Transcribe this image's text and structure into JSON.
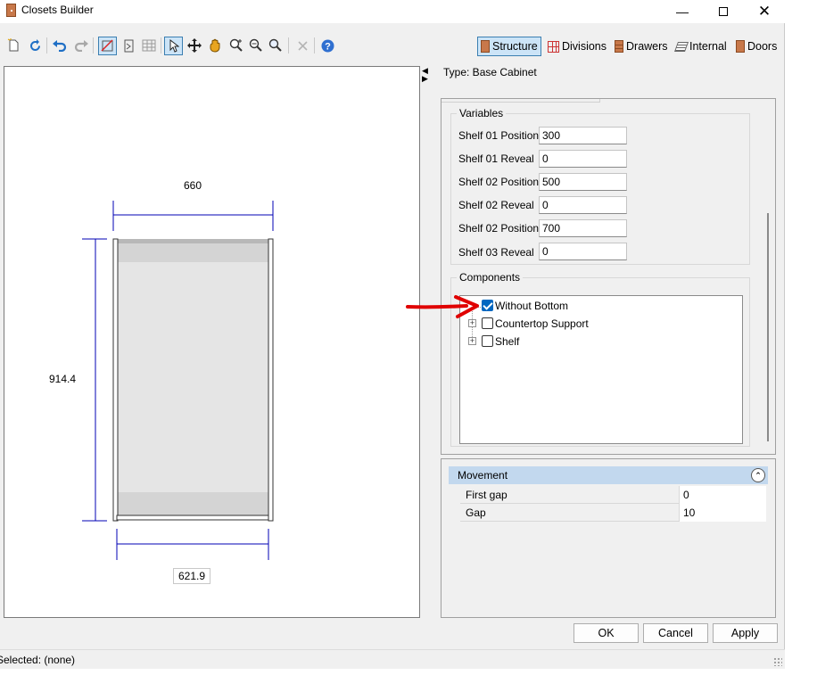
{
  "window": {
    "title": "Closets Builder"
  },
  "toolbar": {
    "tabs": [
      {
        "label": "Structure",
        "icon": "cabinet-icon"
      },
      {
        "label": "Divisions",
        "icon": "grid-icon"
      },
      {
        "label": "Drawers",
        "icon": "drawer-icon"
      },
      {
        "label": "Internal",
        "icon": "internal-icon"
      },
      {
        "label": "Doors",
        "icon": "door-icon"
      }
    ],
    "active_tab": "Structure"
  },
  "drawing": {
    "dim_top": "660",
    "dim_left": "914.4",
    "dim_bottom": "621.9",
    "dim_color": "#0000b4"
  },
  "panel": {
    "type_label": "Type: Base Cabinet",
    "variables": {
      "title": "Variables",
      "rows": [
        {
          "label": "Shelf 01 Position",
          "value": "300"
        },
        {
          "label": "Shelf 01 Reveal",
          "value": "0"
        },
        {
          "label": "Shelf 02 Position",
          "value": "500"
        },
        {
          "label": "Shelf 02 Reveal",
          "value": "0"
        },
        {
          "label": "Shelf 02 Position",
          "value": "700"
        },
        {
          "label": "Shelf 03 Reveal",
          "value": "0"
        }
      ]
    },
    "components": {
      "title": "Components",
      "items": [
        {
          "label": "Without Bottom",
          "checked": true,
          "expandable": false
        },
        {
          "label": "Countertop Support",
          "checked": false,
          "expandable": true
        },
        {
          "label": "Shelf",
          "checked": false,
          "expandable": true
        }
      ]
    }
  },
  "movement": {
    "title": "Movement",
    "rows": [
      {
        "name": "First gap",
        "value": "0"
      },
      {
        "name": "Gap",
        "value": "10"
      }
    ]
  },
  "buttons": {
    "ok": "OK",
    "cancel": "Cancel",
    "apply": "Apply"
  },
  "status": {
    "text": "Selected: (none)"
  },
  "annotation": {
    "arrow_color": "#e00000"
  }
}
